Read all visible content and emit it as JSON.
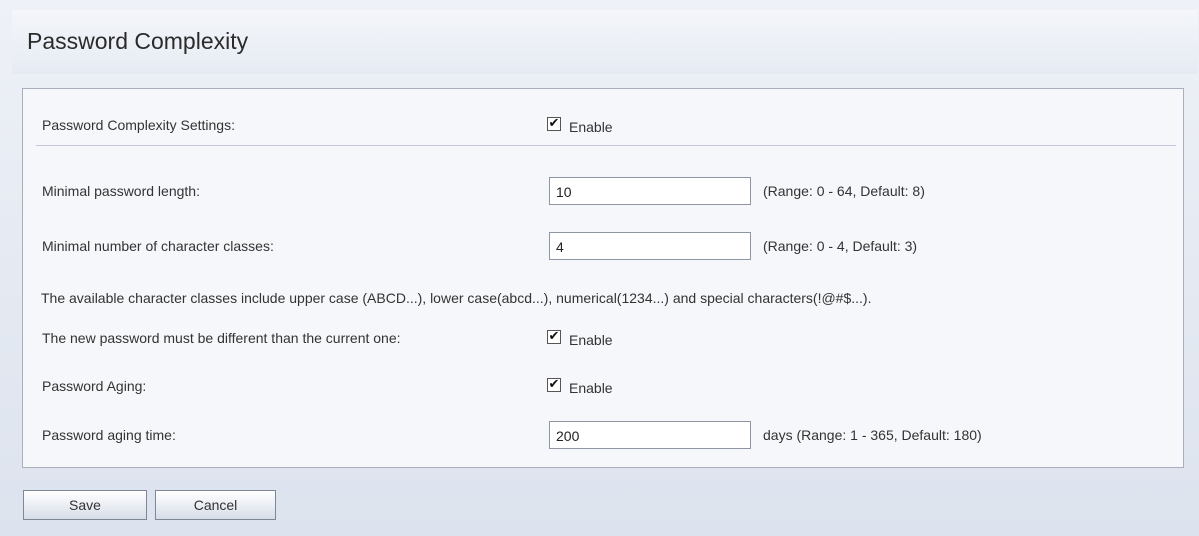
{
  "page": {
    "title": "Password Complexity"
  },
  "settings": {
    "complexity": {
      "label": "Password Complexity Settings:",
      "checked": true,
      "option_label": "Enable"
    },
    "min_length": {
      "label": "Minimal password length:",
      "value": "10",
      "hint": "(Range: 0 - 64, Default: 8)"
    },
    "min_classes": {
      "label": "Minimal number of character classes:",
      "value": "4",
      "hint": "(Range: 0 - 4, Default: 3)"
    },
    "classes_note": "The available character classes include upper case (ABCD...), lower case(abcd...), numerical(1234...) and special characters(!@#$...).",
    "different_password": {
      "label": "The new password must be different than the current one:",
      "checked": true,
      "option_label": "Enable"
    },
    "aging": {
      "label": "Password Aging:",
      "checked": true,
      "option_label": "Enable"
    },
    "aging_time": {
      "label": "Password aging time:",
      "value": "200",
      "hint": "days (Range: 1 - 365, Default: 180)"
    }
  },
  "actions": {
    "save_label": "Save",
    "cancel_label": "Cancel"
  },
  "icons": {
    "checkbox_checked": "check-mark-icon"
  },
  "colors": {
    "panel_border": "#a9b0bc",
    "divider": "#c9c2de",
    "background": "#e3e8f1"
  }
}
